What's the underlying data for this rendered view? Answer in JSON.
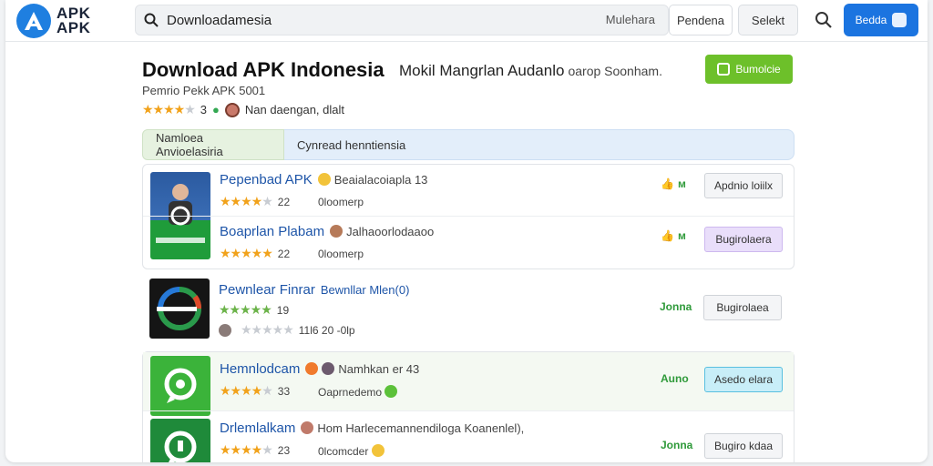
{
  "topbar": {
    "logo_line1": "APK",
    "logo_line2": "APK",
    "search_value": "Downloadamesia",
    "search_scope": "Mulehara",
    "btn_pendena": "Pendena",
    "btn_selekt": "Selekt",
    "btn_primary": "Bedda"
  },
  "header": {
    "title": "Download APK Indonesia",
    "tagline": "Mokil Mangrlan Audanlo",
    "tagline_tail": "oarop Soonham.",
    "subtitle": "Pemrio Pekk APK 5001",
    "rating_value": "3",
    "rating_text": "Nan daengan, dlalt",
    "cta_label": "Bumolcie"
  },
  "tabs": [
    {
      "label": "Namloea Anvioelasiria"
    },
    {
      "label": "Cynread henntiensia"
    }
  ],
  "items": [
    {
      "title": "Pepenbad APK",
      "meta": "Beaialacoiapla 13",
      "rating": "22",
      "sub": "0loomerp",
      "status": "ᴍ",
      "action": "Apdnio loiilx"
    },
    {
      "title": "Boaprlan Plabam",
      "meta": "Jalhaoorlodaaoo",
      "rating": "22",
      "sub": "0loomerp",
      "status": "ᴍ",
      "action": "Bugirolaera"
    },
    {
      "title": "Pewnlear Finrar",
      "meta": "Bewnllar Mlen(0)",
      "rating": "19",
      "sub": "11l6 20 -0lp",
      "status": "Jonna",
      "action": "Bugirolaea"
    },
    {
      "title": "Hemnlodcam",
      "meta": "Namhkan er 43",
      "rating": "33",
      "sub": "Oaprnedemo",
      "status": "Auno",
      "action": "Asedo elara"
    },
    {
      "title": "Drlemlalkam",
      "meta": "Hom Harlecemannendiloga Koanenlel),",
      "rating": "23",
      "sub": "0lcomcder",
      "status": "Jonna",
      "action": "Bugiro kdaa"
    }
  ],
  "colors": {
    "primary": "#1b74e0",
    "success": "#6dc02a",
    "link": "#1e55a8",
    "star": "#f1a21b"
  }
}
